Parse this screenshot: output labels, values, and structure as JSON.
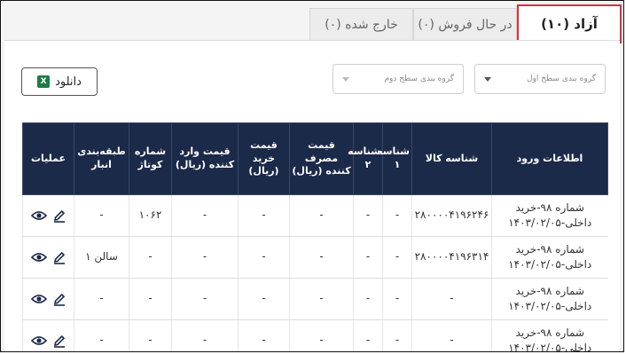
{
  "tabs": [
    {
      "label": "آزاد (۱۰)",
      "active": true
    },
    {
      "label": "در حال فروش (۰)",
      "active": false
    },
    {
      "label": "خارج شده (۰)",
      "active": false
    }
  ],
  "filters": {
    "first_level": "گروه بندی سطح اول",
    "second_level": "گروه بندی سطح دوم"
  },
  "download": {
    "label": "دانلود",
    "icon": "excel-icon"
  },
  "table": {
    "headers": [
      "اطلاعات ورود",
      "شناسه کالا",
      "شناسه ۱",
      "شناسه ۲",
      "قیمت مصرف کننده (ریال)",
      "قیمت خرید (ریال)",
      "قیمت وارد کننده (ریال)",
      "شماره کوتاژ",
      "طبقه‌بندی انبار",
      "عملیات"
    ],
    "rows": [
      {
        "entry": [
          "شماره ۹۸-خرید",
          "داخلی-۱۴۰۳/۰۲/۰۵"
        ],
        "product_id": "۲۸۰۰۰۰۴۱۹۶۲۴۶",
        "id1": "-",
        "id2": "-",
        "consumer_price": "-",
        "purchase_price": "-",
        "importer_price": "-",
        "cottage": "۱۰۶۲",
        "warehouse": "-"
      },
      {
        "entry": [
          "شماره ۹۸-خرید",
          "داخلی-۱۴۰۳/۰۲/۰۵"
        ],
        "product_id": "۲۸۰۰۰۰۴۱۹۶۳۱۴",
        "id1": "-",
        "id2": "-",
        "consumer_price": "-",
        "purchase_price": "-",
        "importer_price": "-",
        "cottage": "-",
        "warehouse": "سالن ۱"
      },
      {
        "entry": [
          "شماره ۹۸-خرید",
          "داخلی-۱۴۰۳/۰۲/۰۵"
        ],
        "product_id": "-",
        "id1": "-",
        "id2": "-",
        "consumer_price": "-",
        "purchase_price": "-",
        "importer_price": "-",
        "cottage": "-",
        "warehouse": "-"
      },
      {
        "entry": [
          "شماره ۹۸-خرید",
          "داخلی-۱۴۰۳/۰۲/۰۵"
        ],
        "product_id": "-",
        "id1": "-",
        "id2": "-",
        "consumer_price": "-",
        "purchase_price": "-",
        "importer_price": "-",
        "cottage": "-",
        "warehouse": "-"
      }
    ]
  }
}
